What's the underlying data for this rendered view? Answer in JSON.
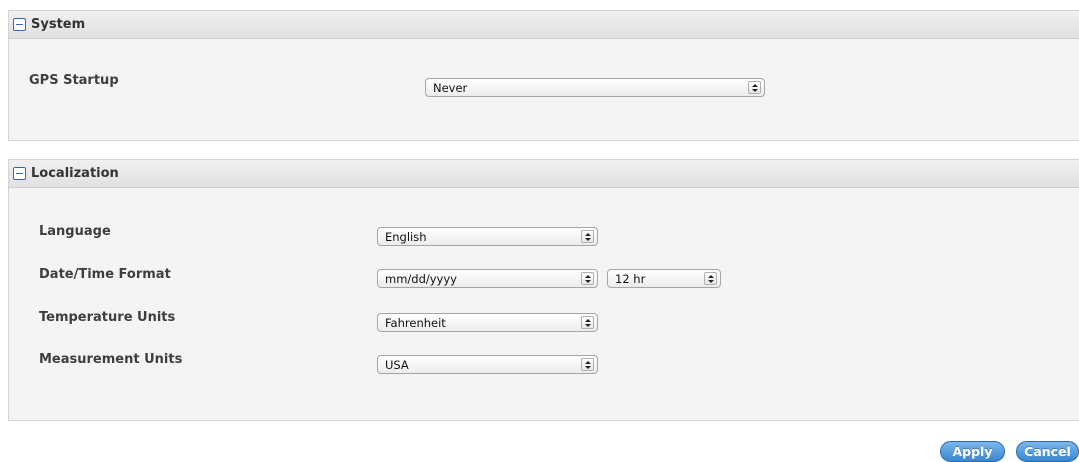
{
  "system": {
    "title": "System",
    "gps_startup": {
      "label": "GPS Startup",
      "value": "Never"
    }
  },
  "localization": {
    "title": "Localization",
    "language": {
      "label": "Language",
      "value": "English"
    },
    "date_time_format": {
      "label": "Date/Time Format",
      "date_value": "mm/dd/yyyy",
      "time_value": "12 hr"
    },
    "temperature_units": {
      "label": "Temperature Units",
      "value": "Fahrenheit"
    },
    "measurement_units": {
      "label": "Measurement Units",
      "value": "USA"
    }
  },
  "actions": {
    "apply_label": "Apply",
    "cancel_label": "Cancel"
  },
  "colors": {
    "accent": "#3a86d0",
    "panel_background": "#f4f4f4",
    "header_background": "#e6e6e6"
  },
  "icons": {
    "section_toggle": "collapse-minus-icon",
    "select_indicator": "up-down-arrows-icon"
  }
}
